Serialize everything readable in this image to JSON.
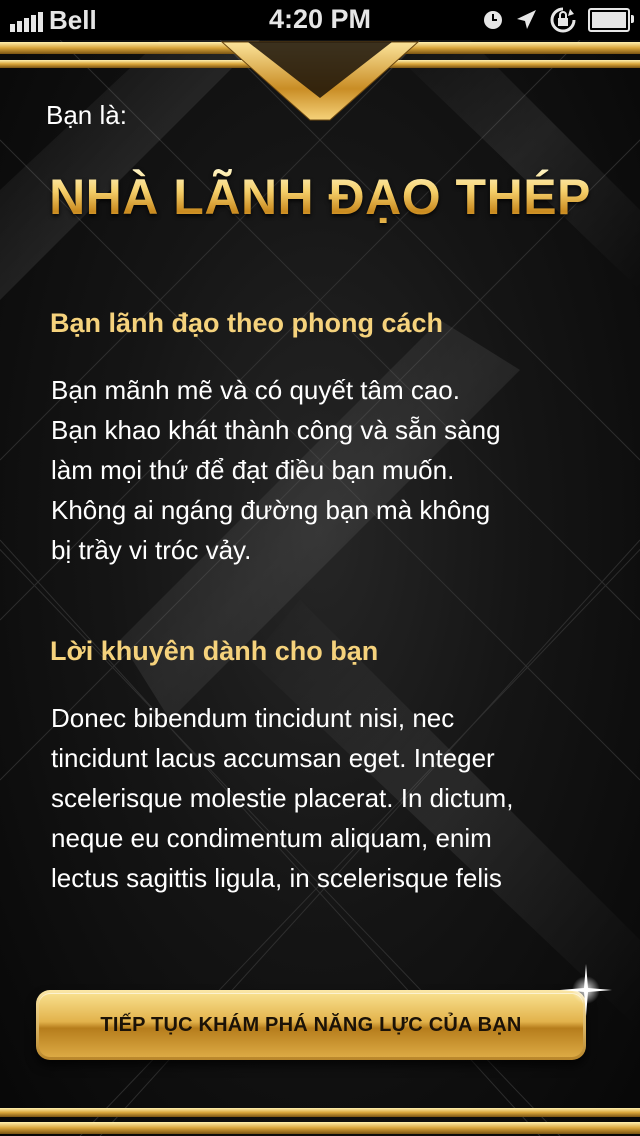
{
  "status_bar": {
    "carrier": "Bell",
    "time": "4:20 PM",
    "icons": [
      "signal-icon",
      "alarm-clock-icon",
      "location-arrow-icon",
      "rotation-lock-icon",
      "battery-icon"
    ]
  },
  "header": {
    "intro": "Bạn là:",
    "title": "NHÀ LÃNH ĐẠO THÉP"
  },
  "sections": [
    {
      "heading": "Bạn lãnh đạo theo phong cách",
      "lines": [
        "Bạn mãnh mẽ và có quyết tâm cao.",
        "Bạn khao khát thành công và sẵn sàng",
        "làm mọi thứ để đạt điều bạn muốn.",
        "Không ai ngáng đường bạn mà không",
        "bị trầy vi tróc vảy."
      ]
    },
    {
      "heading": "Lời khuyên dành cho bạn",
      "lines": [
        "Donec bibendum tincidunt nisi, nec",
        "tincidunt lacus accumsan eget. Integer",
        "scelerisque molestie placerat. In dictum,",
        "neque eu condimentum aliquam, enim",
        "lectus sagittis ligula, in scelerisque felis"
      ]
    }
  ],
  "cta": {
    "label": "TIẾP TỤC KHÁM PHÁ NĂNG LỰC CỦA BẠN"
  },
  "colors": {
    "gold": "#f5d27c",
    "background": "#0b0b0b",
    "text": "#ffffff"
  }
}
